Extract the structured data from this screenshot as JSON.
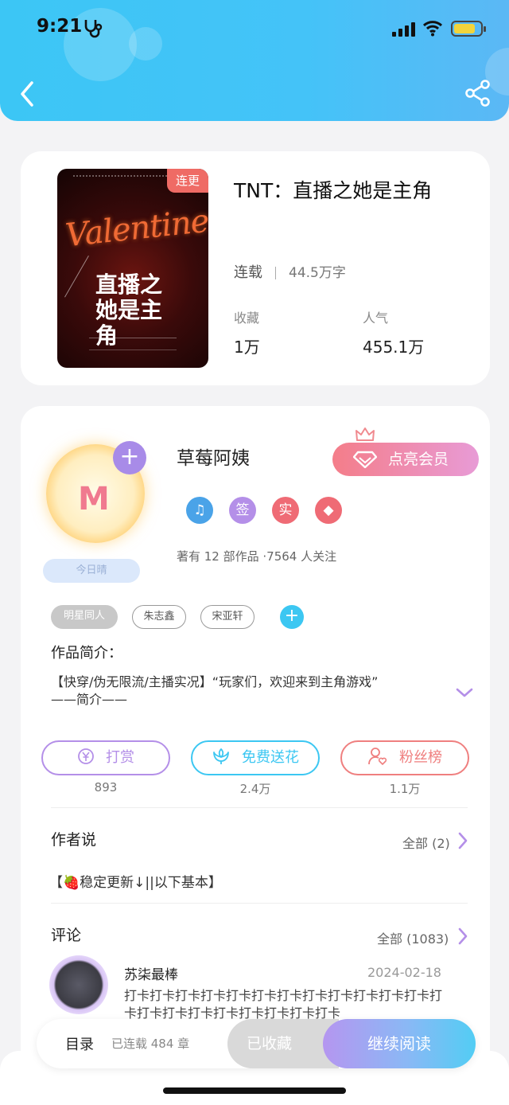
{
  "status_bar": {
    "time": "9:21"
  },
  "book": {
    "serial_badge": "连更",
    "title": "TNT：直播之她是主角",
    "status": "连载",
    "word_count": "44.5万字",
    "stats": [
      {
        "label": "收藏",
        "value": "1万"
      },
      {
        "label": "人气",
        "value": "455.1万"
      }
    ],
    "cover": {
      "script_title": "Valentine",
      "cn_title": "直播之她是主角"
    }
  },
  "author": {
    "name": "草莓阿姨",
    "vip_button": "点亮会员",
    "honors": [
      {
        "name": "music",
        "text": "♫",
        "color": "#4aa3e8"
      },
      {
        "name": "signed",
        "text": "签",
        "color": "#b48fe8"
      },
      {
        "name": "verified",
        "text": "实",
        "color": "#ef6b75"
      },
      {
        "name": "diamond",
        "text": "◆",
        "color": "#ef6b75"
      }
    ],
    "works_info": "著有 12 部作品 ·7564 人关注",
    "weather": "今日晴",
    "avatar_text": "M"
  },
  "tags": [
    "明星同人",
    "朱志鑫",
    "宋亚轩"
  ],
  "intro": {
    "heading": "作品简介：",
    "line1": "【快穿/伪无限流/主播实况】“玩家们，欢迎来到主角游戏”",
    "line2": "——简介——"
  },
  "actions": [
    {
      "label": "打赏",
      "count": "893",
      "color": "#b48fe8"
    },
    {
      "label": "免费送花",
      "count": "2.4万",
      "color": "#3cc7f2"
    },
    {
      "label": "粉丝榜",
      "count": "1.1万",
      "color": "#ef7f7f"
    }
  ],
  "author_say": {
    "heading": "作者说",
    "all": "全部 (2)",
    "text": "【🍓稳定更新↓||以下基本】"
  },
  "comments": {
    "heading": "评论",
    "all": "全部 (1083)",
    "first": {
      "user": "苏柒最棒",
      "date": "2024-02-18",
      "body": "打卡打卡打卡打卡打卡打卡打卡打卡打卡打卡打卡打卡打卡打卡打卡打卡打卡打卡打卡打卡打卡"
    }
  },
  "bottom_bar": {
    "toc": "目录",
    "chapters": "已连载 484 章",
    "collected": "已收藏",
    "continue": "继续阅读"
  },
  "colors": {
    "header": "#3cc6f5",
    "accent_purple": "#a88be8",
    "accent_red": "#ef6b65"
  }
}
